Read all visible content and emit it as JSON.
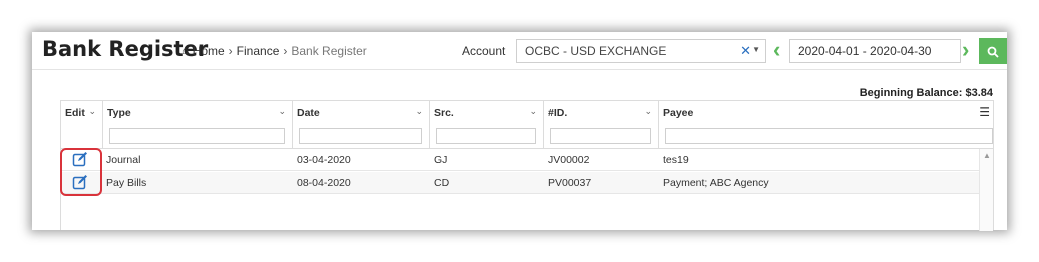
{
  "header": {
    "title": "Bank Register",
    "breadcrumb": {
      "home": "Home",
      "section": "Finance",
      "current": "Bank Register"
    },
    "account_label": "Account",
    "account_value": "OCBC - USD EXCHANGE",
    "date_range": "2020-04-01 - 2020-04-30"
  },
  "icons": {
    "home": "home-icon",
    "clear": "close-icon",
    "prev": "chevron-left-icon",
    "next": "chevron-right-icon",
    "search": "search-icon",
    "edit": "edit-icon",
    "menu": "hamburger-icon"
  },
  "balance": "Beginning Balance: $3.84",
  "grid": {
    "columns": [
      "Edit",
      "Type",
      "Date",
      "Src.",
      "#ID.",
      "Payee"
    ],
    "rows": [
      {
        "type": "Journal",
        "date": "03-04-2020",
        "src": "GJ",
        "id": "JV00002",
        "payee": "tes19"
      },
      {
        "type": "Pay Bills",
        "date": "08-04-2020",
        "src": "CD",
        "id": "PV00037",
        "payee": "Payment; ABC Agency"
      }
    ]
  },
  "colors": {
    "accent_green": "#5cb85c",
    "highlight_red": "#d9333b",
    "link_blue": "#2a6fbf"
  }
}
